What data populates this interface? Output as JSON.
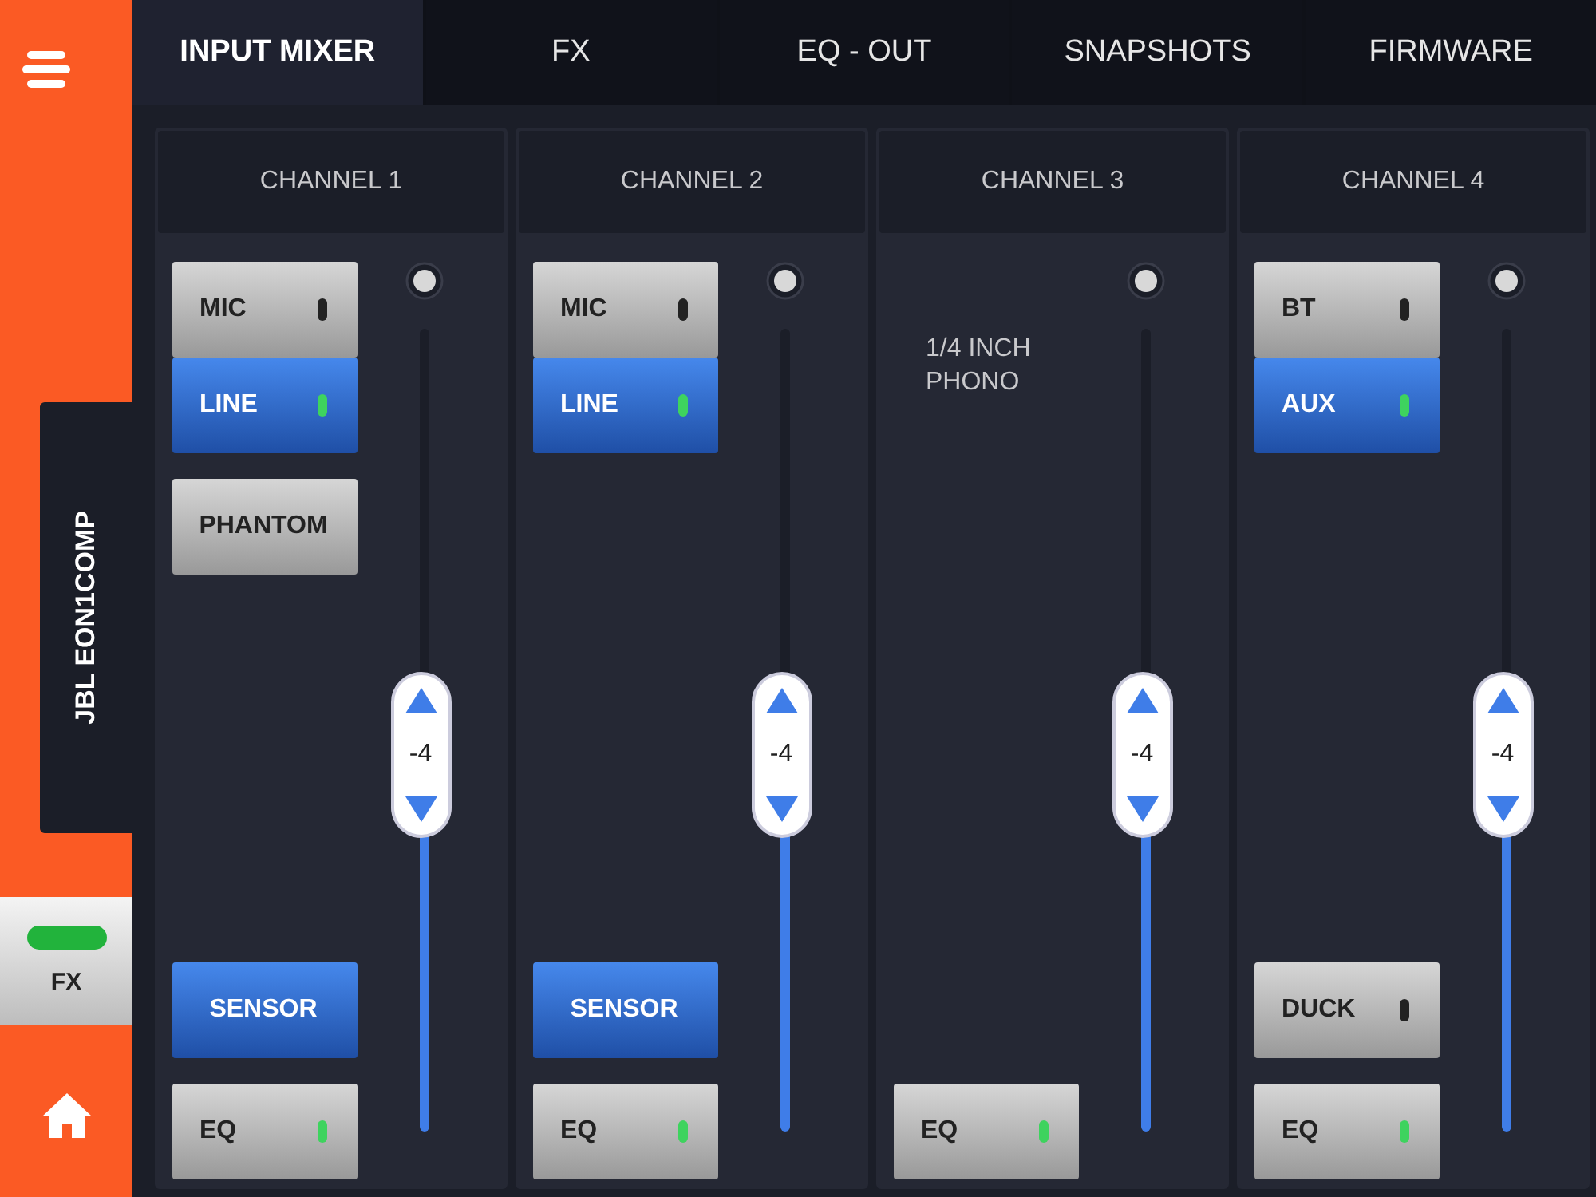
{
  "sidebar": {
    "device": "JBL EON1COMP",
    "fx": {
      "label": "FX",
      "on": true
    }
  },
  "tabs": [
    {
      "label": "INPUT MIXER",
      "selected": true
    },
    {
      "label": "FX",
      "selected": false
    },
    {
      "label": "EQ - OUT",
      "selected": false
    },
    {
      "label": "SNAPSHOTS",
      "selected": false
    },
    {
      "label": "FIRMWARE",
      "selected": false
    }
  ],
  "channels": [
    {
      "name": "CHANNEL 1",
      "top_groups": [
        [
          {
            "label": "MIC",
            "on": false,
            "led": false
          },
          {
            "label": "LINE",
            "on": true,
            "led": true
          }
        ],
        [
          {
            "label": "PHANTOM",
            "on": false
          }
        ]
      ],
      "bottom": [
        {
          "label": "SENSOR",
          "on": true
        },
        {
          "label": "EQ",
          "on": false,
          "led": true
        }
      ],
      "fader": {
        "reading": "-4",
        "level": 0.47
      }
    },
    {
      "name": "CHANNEL 2",
      "top_groups": [
        [
          {
            "label": "MIC",
            "on": false,
            "led": false
          },
          {
            "label": "LINE",
            "on": true,
            "led": true
          }
        ]
      ],
      "bottom": [
        {
          "label": "SENSOR",
          "on": true
        },
        {
          "label": "EQ",
          "on": false,
          "led": true
        }
      ],
      "fader": {
        "reading": "-4",
        "level": 0.47
      }
    },
    {
      "name": "CHANNEL 3",
      "note": "1/4 INCH\nPHONO",
      "bottom": [
        {
          "label": "EQ",
          "on": false,
          "led": true
        }
      ],
      "fader": {
        "reading": "-4",
        "level": 0.47
      }
    },
    {
      "name": "CHANNEL 4",
      "top_groups": [
        [
          {
            "label": "BT",
            "on": false,
            "led": false
          },
          {
            "label": "AUX",
            "on": true,
            "led": true
          }
        ]
      ],
      "bottom": [
        {
          "label": "DUCK",
          "on": false,
          "led": false
        },
        {
          "label": "EQ",
          "on": false,
          "led": true
        }
      ],
      "fader": {
        "reading": "-4",
        "level": 0.47
      }
    }
  ]
}
